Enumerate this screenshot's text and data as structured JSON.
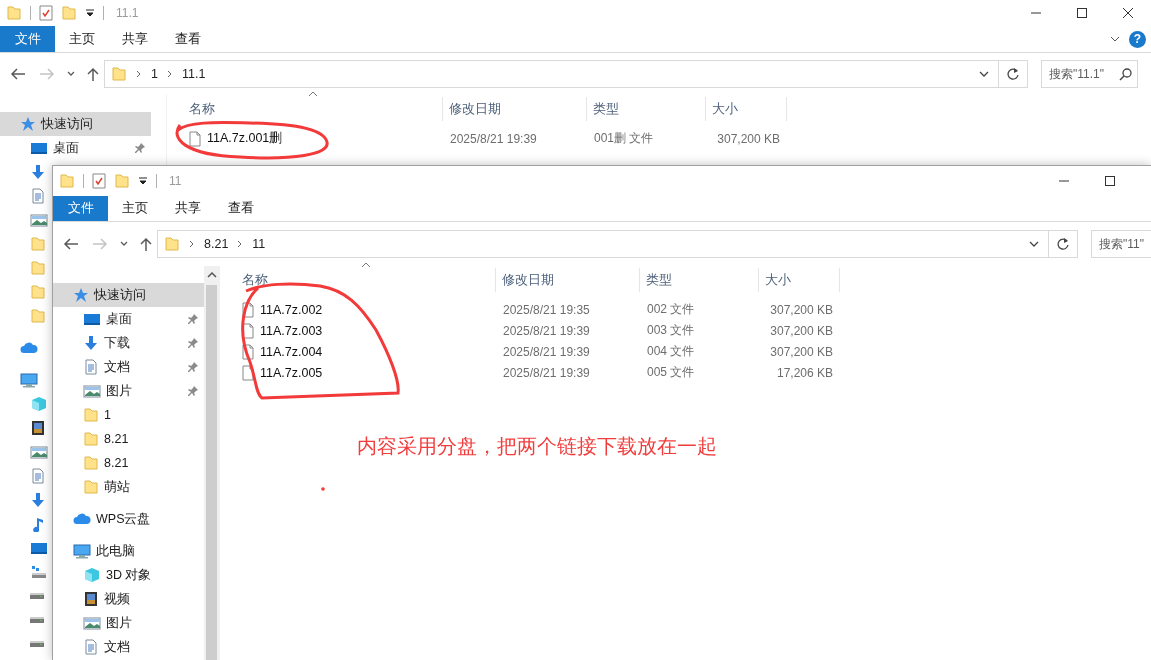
{
  "windows": [
    {
      "kind": "behind",
      "title": "11.1",
      "ribbon_tabs": [
        {
          "label": "文件",
          "selected": true
        },
        {
          "label": "主页",
          "selected": false
        },
        {
          "label": "共享",
          "selected": false
        },
        {
          "label": "查看",
          "selected": false
        }
      ],
      "help": "?",
      "navigation": [
        {
          "kind": "back",
          "disabled": false
        },
        {
          "kind": "forward",
          "disabled": true
        },
        {
          "kind": "recent",
          "disabled": false
        },
        {
          "kind": "up",
          "disabled": false
        }
      ],
      "path": [
        "1",
        "11.1"
      ],
      "search": {
        "placeholder": "搜索\"11.1\""
      },
      "sidebar": [
        {
          "kind": "quick",
          "label": "快速访问",
          "selected": true,
          "children": [
            {
              "kind": "desktop",
              "label": "桌面",
              "selected": false,
              "pinned": true
            },
            {
              "kind": "download",
              "selected": false
            },
            {
              "kind": "document",
              "selected": false
            },
            {
              "kind": "picture",
              "selected": false
            },
            {
              "kind": "folder",
              "selected": false
            },
            {
              "kind": "folder",
              "selected": false
            },
            {
              "kind": "folder",
              "selected": false
            },
            {
              "kind": "folder",
              "selected": false
            }
          ]
        },
        {
          "kind": "cloud",
          "selected": false
        },
        {
          "kind": "computer",
          "selected": false,
          "children": [
            {
              "kind": "cube",
              "selected": false
            },
            {
              "kind": "video",
              "selected": false
            },
            {
              "kind": "picture",
              "selected": false
            },
            {
              "kind": "document",
              "selected": false
            },
            {
              "kind": "download",
              "selected": false
            },
            {
              "kind": "music",
              "selected": false
            },
            {
              "kind": "desktop",
              "selected": false
            },
            {
              "kind": "netdrive",
              "selected": false
            },
            {
              "kind": "drive",
              "selected": false
            },
            {
              "kind": "drive",
              "selected": false
            },
            {
              "kind": "drive",
              "selected": false
            }
          ]
        }
      ],
      "columns": [
        {
          "label": "名称",
          "sorted": true
        },
        {
          "label": "修改日期",
          "sorted": false
        },
        {
          "label": "类型",
          "sorted": false
        },
        {
          "label": "大小",
          "sorted": false
        }
      ],
      "files": [
        {
          "name": "11A.7z.001删",
          "date": "2025/8/21 19:39",
          "type": "001删 文件",
          "size": "307,200 KB"
        }
      ]
    },
    {
      "kind": "front",
      "title": "11",
      "ribbon_tabs": [
        {
          "label": "文件",
          "selected": true
        },
        {
          "label": "主页",
          "selected": false
        },
        {
          "label": "共享",
          "selected": false
        },
        {
          "label": "查看",
          "selected": false
        }
      ],
      "navigation": [
        {
          "kind": "back",
          "disabled": false
        },
        {
          "kind": "forward",
          "disabled": true
        },
        {
          "kind": "recent",
          "disabled": false
        },
        {
          "kind": "up",
          "disabled": false
        }
      ],
      "path": [
        "8.21",
        "11"
      ],
      "search": {
        "placeholder": "搜索\"11\""
      },
      "sidebar": [
        {
          "kind": "quick",
          "label": "快速访问",
          "selected": true,
          "children": [
            {
              "kind": "desktop",
              "label": "桌面",
              "selected": false,
              "pinned": true
            },
            {
              "kind": "download",
              "label": "下载",
              "selected": false,
              "pinned": true
            },
            {
              "kind": "document",
              "label": "文档",
              "selected": false,
              "pinned": true
            },
            {
              "kind": "picture",
              "label": "图片",
              "selected": false,
              "pinned": true
            },
            {
              "kind": "folder",
              "label": "1",
              "selected": false,
              "pinned": false
            },
            {
              "kind": "folder",
              "label": "8.21",
              "selected": false,
              "pinned": false
            },
            {
              "kind": "folder",
              "label": "8.21",
              "selected": false,
              "pinned": false
            },
            {
              "kind": "folder",
              "label": "萌站",
              "selected": false,
              "pinned": false
            }
          ]
        },
        {
          "kind": "cloud",
          "label": "WPS云盘",
          "selected": false
        },
        {
          "kind": "computer",
          "label": "此电脑",
          "selected": false,
          "children": [
            {
              "kind": "cube",
              "label": "3D 对象",
              "selected": false
            },
            {
              "kind": "video",
              "label": "视频",
              "selected": false
            },
            {
              "kind": "picture",
              "label": "图片",
              "selected": false
            },
            {
              "kind": "document",
              "label": "文档",
              "selected": false
            }
          ]
        }
      ],
      "columns": [
        {
          "label": "名称",
          "sorted": true
        },
        {
          "label": "修改日期",
          "sorted": false
        },
        {
          "label": "类型",
          "sorted": false
        },
        {
          "label": "大小",
          "sorted": false
        }
      ],
      "files": [
        {
          "name": "11A.7z.002",
          "date": "2025/8/21 19:35",
          "type": "002 文件",
          "size": "307,200 KB"
        },
        {
          "name": "11A.7z.003",
          "date": "2025/8/21 19:39",
          "type": "003 文件",
          "size": "307,200 KB"
        },
        {
          "name": "11A.7z.004",
          "date": "2025/8/21 19:39",
          "type": "004 文件",
          "size": "307,200 KB"
        },
        {
          "name": "11A.7z.005",
          "date": "2025/8/21 19:39",
          "type": "005 文件",
          "size": "17,206 KB"
        }
      ]
    }
  ],
  "annotation": {
    "note": "内容采用分盘，把两个链接下载放在一起"
  }
}
